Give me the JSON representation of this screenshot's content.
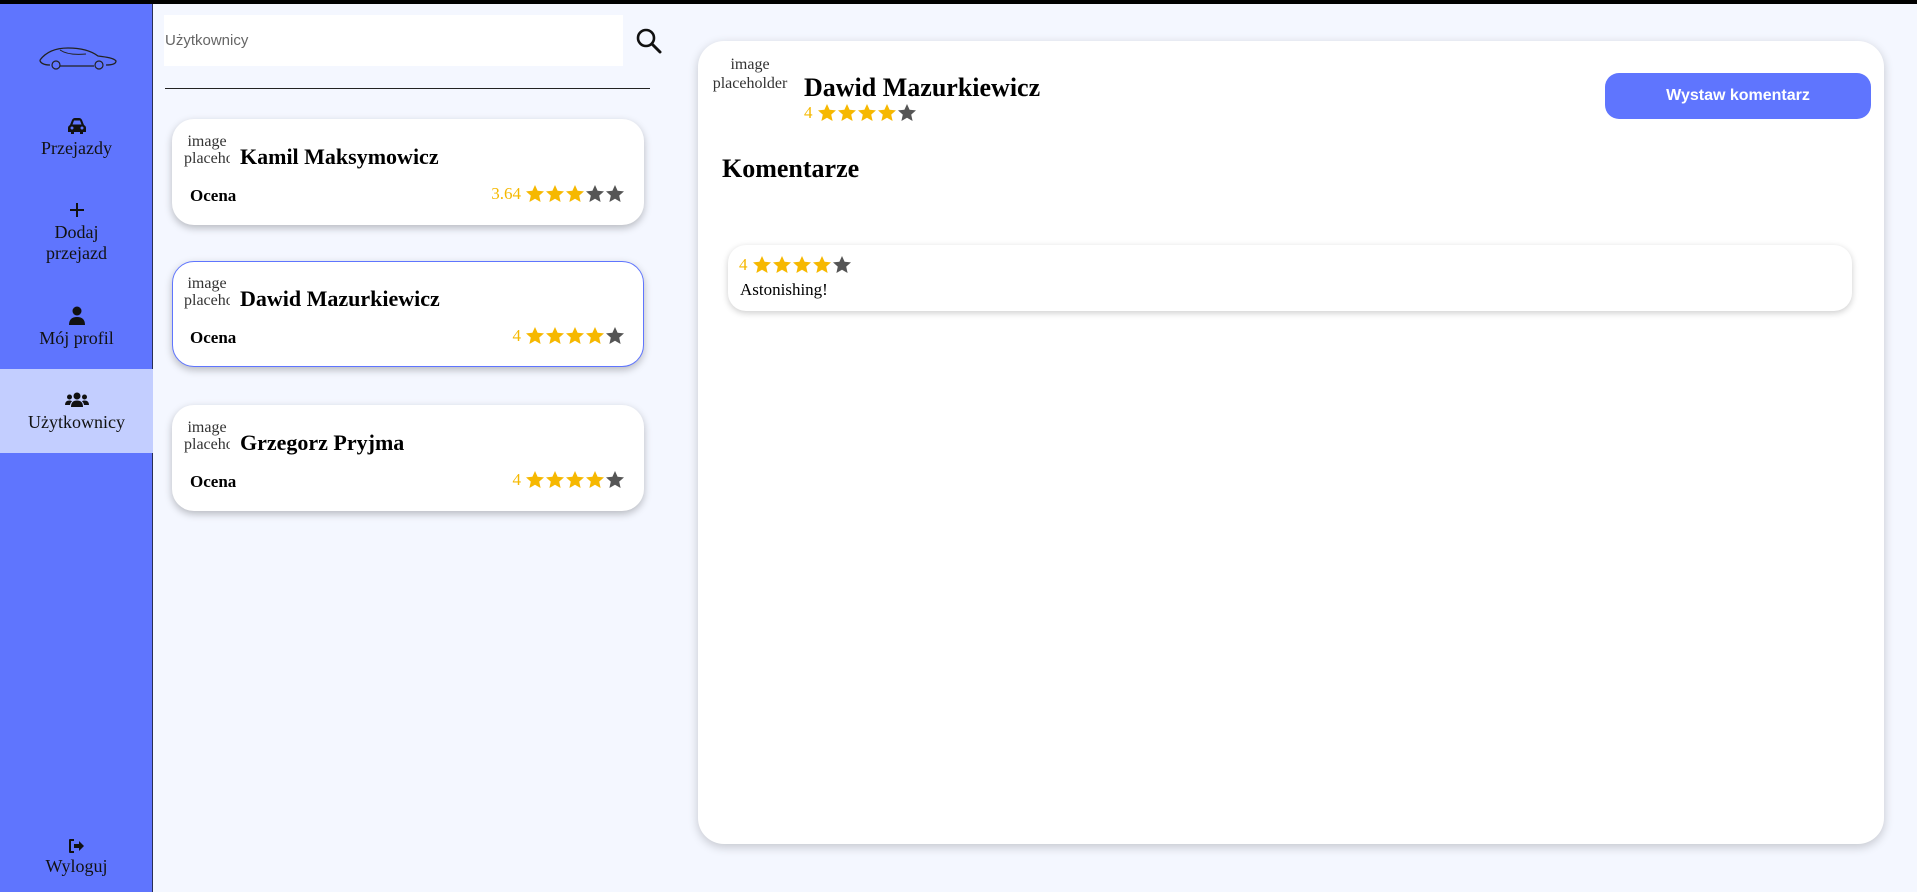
{
  "colors": {
    "accent": "#5f75fe",
    "active_nav": "#c3ceff",
    "star_on": "#f6b800",
    "star_off": "#555555",
    "background": "#f4f7ff"
  },
  "sidebar": {
    "logo_icon": "car-logo-icon",
    "items": [
      {
        "label": "Przejazdy",
        "icon": "car-icon"
      },
      {
        "label": "Dodaj przejazd",
        "icon": "plus-icon"
      },
      {
        "label": "Mój profil",
        "icon": "user-icon"
      },
      {
        "label": "Użytkownicy",
        "icon": "users-icon",
        "active": true
      }
    ],
    "logout": {
      "label": "Wyloguj",
      "icon": "sign-out-icon"
    }
  },
  "search": {
    "placeholder": "Użytkownicy",
    "value": "",
    "icon": "search-icon"
  },
  "users": [
    {
      "name": "Kamil Maksymowicz",
      "rating_label": "Ocena",
      "rating": "3.64",
      "stars": 3,
      "avatar_alt": "image placeholder"
    },
    {
      "name": "Dawid Mazurkiewicz",
      "rating_label": "Ocena",
      "rating": "4",
      "stars": 4,
      "avatar_alt": "image placeholder",
      "selected": true
    },
    {
      "name": "Grzegorz Pryjma",
      "rating_label": "Ocena",
      "rating": "4",
      "stars": 4,
      "avatar_alt": "image placeholder"
    }
  ],
  "profile": {
    "avatar_alt": "image placeholder",
    "name": "Dawid Mazurkiewicz",
    "rating": "4",
    "stars": 4,
    "comment_button": "Wystaw komentarz",
    "comments_title": "Komentarze",
    "comments": [
      {
        "rating": "4",
        "stars": 4,
        "text": "Astonishing!"
      }
    ]
  }
}
